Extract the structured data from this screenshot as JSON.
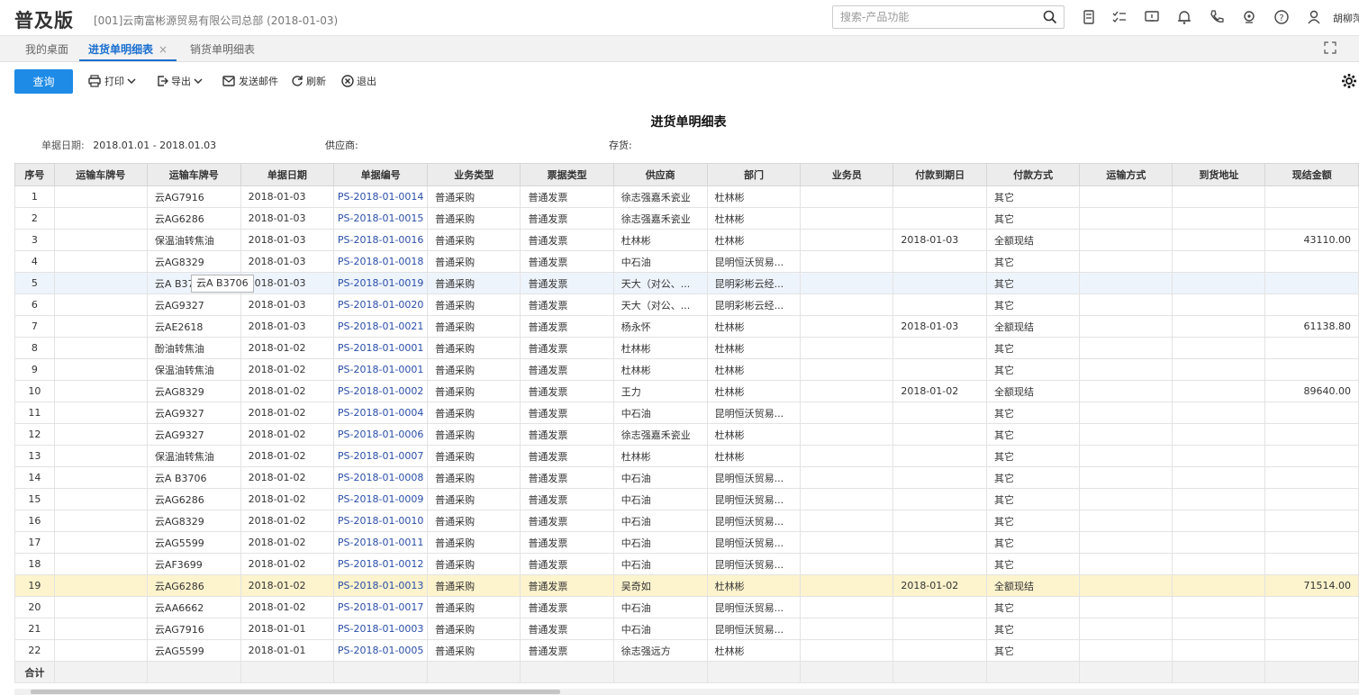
{
  "header": {
    "brand": "普及版",
    "company": "[001]云南富彬源贸易有限公司总部   (2018-01-03)",
    "search_placeholder": "搜索-产品功能",
    "user": "胡柳萍",
    "icons": [
      "search-icon",
      "calculator-icon",
      "task-list-icon",
      "message-icon",
      "bell-icon",
      "phone-icon",
      "location-icon",
      "help-icon",
      "user-icon"
    ]
  },
  "tabs": [
    {
      "label": "我的桌面"
    },
    {
      "label": "进货单明细表",
      "close": "×"
    },
    {
      "label": "销货单明细表"
    }
  ],
  "toolbar": {
    "query": "查询",
    "print": "打印",
    "export": "导出",
    "email": "发送邮件",
    "refresh": "刷新",
    "exit": "退出"
  },
  "report": {
    "title": "进货单明细表",
    "date_label": "单据日期:",
    "date_value": "2018.01.01 - 2018.01.03",
    "supplier_label": "供应商:",
    "stock_label": "存货:"
  },
  "table": {
    "columns": [
      "序号",
      "运输车牌号",
      "运输车牌号",
      "单据日期",
      "单据编号",
      "业务类型",
      "票据类型",
      "供应商",
      "部门",
      "业务员",
      "付款到期日",
      "付款方式",
      "运输方式",
      "到货地址",
      "现结金额"
    ],
    "rows": [
      {
        "no": "1",
        "plate1": "",
        "plate2": "云AG7916",
        "date": "2018-01-03",
        "code": "PS-2018-01-0014",
        "biz": "普通采购",
        "bill": "普通发票",
        "supplier": "徐志强嘉禾瓷业",
        "dept": "杜林彬",
        "staff": "",
        "due": "",
        "pay": "其它",
        "ship": "",
        "addr": "",
        "amount": ""
      },
      {
        "no": "2",
        "plate1": "",
        "plate2": "云AG6286",
        "date": "2018-01-03",
        "code": "PS-2018-01-0015",
        "biz": "普通采购",
        "bill": "普通发票",
        "supplier": "徐志强嘉禾瓷业",
        "dept": "杜林彬",
        "staff": "",
        "due": "",
        "pay": "其它",
        "ship": "",
        "addr": "",
        "amount": ""
      },
      {
        "no": "3",
        "plate1": "",
        "plate2": "保温油转焦油",
        "date": "2018-01-03",
        "code": "PS-2018-01-0016",
        "biz": "普通采购",
        "bill": "普通发票",
        "supplier": "杜林彬",
        "dept": "杜林彬",
        "staff": "",
        "due": "2018-01-03",
        "pay": "全额现结",
        "ship": "",
        "addr": "",
        "amount": "43110.00"
      },
      {
        "no": "4",
        "plate1": "",
        "plate2": "云AG8329",
        "date": "2018-01-03",
        "code": "PS-2018-01-0018",
        "biz": "普通采购",
        "bill": "普通发票",
        "supplier": "中石油",
        "dept": "昆明恒沃贸易...",
        "staff": "",
        "due": "",
        "pay": "其它",
        "ship": "",
        "addr": "",
        "amount": ""
      },
      {
        "no": "5",
        "plate1": "",
        "plate2": "云A B37",
        "date": "2018-01-03",
        "code": "PS-2018-01-0019",
        "biz": "普通采购",
        "bill": "普通发票",
        "supplier": "天大（对公、...",
        "dept": "昆明彩彬云经...",
        "staff": "",
        "due": "",
        "pay": "其它",
        "ship": "",
        "addr": "",
        "amount": ""
      },
      {
        "no": "6",
        "plate1": "",
        "plate2": "云AG9327",
        "date": "2018-01-03",
        "code": "PS-2018-01-0020",
        "biz": "普通采购",
        "bill": "普通发票",
        "supplier": "天大（对公、...",
        "dept": "昆明彩彬云经...",
        "staff": "",
        "due": "",
        "pay": "其它",
        "ship": "",
        "addr": "",
        "amount": ""
      },
      {
        "no": "7",
        "plate1": "",
        "plate2": "云AE2618",
        "date": "2018-01-03",
        "code": "PS-2018-01-0021",
        "biz": "普通采购",
        "bill": "普通发票",
        "supplier": "杨永怀",
        "dept": "杜林彬",
        "staff": "",
        "due": "2018-01-03",
        "pay": "全额现结",
        "ship": "",
        "addr": "",
        "amount": "61138.80"
      },
      {
        "no": "8",
        "plate1": "",
        "plate2": "酚油转焦油",
        "date": "2018-01-02",
        "code": "PS-2018-01-0001",
        "biz": "普通采购",
        "bill": "普通发票",
        "supplier": "杜林彬",
        "dept": "杜林彬",
        "staff": "",
        "due": "",
        "pay": "其它",
        "ship": "",
        "addr": "",
        "amount": ""
      },
      {
        "no": "9",
        "plate1": "",
        "plate2": "保温油转焦油",
        "date": "2018-01-02",
        "code": "PS-2018-01-0001",
        "biz": "普通采购",
        "bill": "普通发票",
        "supplier": "杜林彬",
        "dept": "杜林彬",
        "staff": "",
        "due": "",
        "pay": "其它",
        "ship": "",
        "addr": "",
        "amount": ""
      },
      {
        "no": "10",
        "plate1": "",
        "plate2": "云AG8329",
        "date": "2018-01-02",
        "code": "PS-2018-01-0002",
        "biz": "普通采购",
        "bill": "普通发票",
        "supplier": "王力",
        "dept": "杜林彬",
        "staff": "",
        "due": "2018-01-02",
        "pay": "全额现结",
        "ship": "",
        "addr": "",
        "amount": "89640.00"
      },
      {
        "no": "11",
        "plate1": "",
        "plate2": "云AG9327",
        "date": "2018-01-02",
        "code": "PS-2018-01-0004",
        "biz": "普通采购",
        "bill": "普通发票",
        "supplier": "中石油",
        "dept": "昆明恒沃贸易...",
        "staff": "",
        "due": "",
        "pay": "其它",
        "ship": "",
        "addr": "",
        "amount": ""
      },
      {
        "no": "12",
        "plate1": "",
        "plate2": "云AG9327",
        "date": "2018-01-02",
        "code": "PS-2018-01-0006",
        "biz": "普通采购",
        "bill": "普通发票",
        "supplier": "徐志强嘉禾瓷业",
        "dept": "杜林彬",
        "staff": "",
        "due": "",
        "pay": "其它",
        "ship": "",
        "addr": "",
        "amount": ""
      },
      {
        "no": "13",
        "plate1": "",
        "plate2": "保温油转焦油",
        "date": "2018-01-02",
        "code": "PS-2018-01-0007",
        "biz": "普通采购",
        "bill": "普通发票",
        "supplier": "杜林彬",
        "dept": "杜林彬",
        "staff": "",
        "due": "",
        "pay": "其它",
        "ship": "",
        "addr": "",
        "amount": ""
      },
      {
        "no": "14",
        "plate1": "",
        "plate2": "云A B3706",
        "date": "2018-01-02",
        "code": "PS-2018-01-0008",
        "biz": "普通采购",
        "bill": "普通发票",
        "supplier": "中石油",
        "dept": "昆明恒沃贸易...",
        "staff": "",
        "due": "",
        "pay": "其它",
        "ship": "",
        "addr": "",
        "amount": ""
      },
      {
        "no": "15",
        "plate1": "",
        "plate2": "云AG6286",
        "date": "2018-01-02",
        "code": "PS-2018-01-0009",
        "biz": "普通采购",
        "bill": "普通发票",
        "supplier": "中石油",
        "dept": "昆明恒沃贸易...",
        "staff": "",
        "due": "",
        "pay": "其它",
        "ship": "",
        "addr": "",
        "amount": ""
      },
      {
        "no": "16",
        "plate1": "",
        "plate2": "云AG8329",
        "date": "2018-01-02",
        "code": "PS-2018-01-0010",
        "biz": "普通采购",
        "bill": "普通发票",
        "supplier": "中石油",
        "dept": "昆明恒沃贸易...",
        "staff": "",
        "due": "",
        "pay": "其它",
        "ship": "",
        "addr": "",
        "amount": ""
      },
      {
        "no": "17",
        "plate1": "",
        "plate2": "云AG5599",
        "date": "2018-01-02",
        "code": "PS-2018-01-0011",
        "biz": "普通采购",
        "bill": "普通发票",
        "supplier": "中石油",
        "dept": "昆明恒沃贸易...",
        "staff": "",
        "due": "",
        "pay": "其它",
        "ship": "",
        "addr": "",
        "amount": ""
      },
      {
        "no": "18",
        "plate1": "",
        "plate2": "云AF3699",
        "date": "2018-01-02",
        "code": "PS-2018-01-0012",
        "biz": "普通采购",
        "bill": "普通发票",
        "supplier": "中石油",
        "dept": "昆明恒沃贸易...",
        "staff": "",
        "due": "",
        "pay": "其它",
        "ship": "",
        "addr": "",
        "amount": ""
      },
      {
        "no": "19",
        "plate1": "",
        "plate2": "云AG6286",
        "date": "2018-01-02",
        "code": "PS-2018-01-0013",
        "biz": "普通采购",
        "bill": "普通发票",
        "supplier": "吴奇如",
        "dept": "杜林彬",
        "staff": "",
        "due": "2018-01-02",
        "pay": "全额现结",
        "ship": "",
        "addr": "",
        "amount": "71514.00"
      },
      {
        "no": "20",
        "plate1": "",
        "plate2": "云AA6662",
        "date": "2018-01-02",
        "code": "PS-2018-01-0017",
        "biz": "普通采购",
        "bill": "普通发票",
        "supplier": "中石油",
        "dept": "昆明恒沃贸易...",
        "staff": "",
        "due": "",
        "pay": "其它",
        "ship": "",
        "addr": "",
        "amount": ""
      },
      {
        "no": "21",
        "plate1": "",
        "plate2": "云AG7916",
        "date": "2018-01-01",
        "code": "PS-2018-01-0003",
        "biz": "普通采购",
        "bill": "普通发票",
        "supplier": "中石油",
        "dept": "昆明恒沃贸易...",
        "staff": "",
        "due": "",
        "pay": "其它",
        "ship": "",
        "addr": "",
        "amount": ""
      },
      {
        "no": "22",
        "plate1": "",
        "plate2": "云AG5599",
        "date": "2018-01-01",
        "code": "PS-2018-01-0005",
        "biz": "普通采购",
        "bill": "普通发票",
        "supplier": "徐志强远方",
        "dept": "杜林彬",
        "staff": "",
        "due": "",
        "pay": "其它",
        "ship": "",
        "addr": "",
        "amount": ""
      }
    ],
    "total_label": "合计",
    "hover_row": 5,
    "selected_row": 19
  },
  "tooltip": "云A B3706",
  "colors": {
    "accent": "#1e8be6",
    "tab_active": "#1a6fcf",
    "link": "#2a4ea8",
    "selected_row": "#fdf3cd",
    "hover_row": "#eef4fc"
  }
}
